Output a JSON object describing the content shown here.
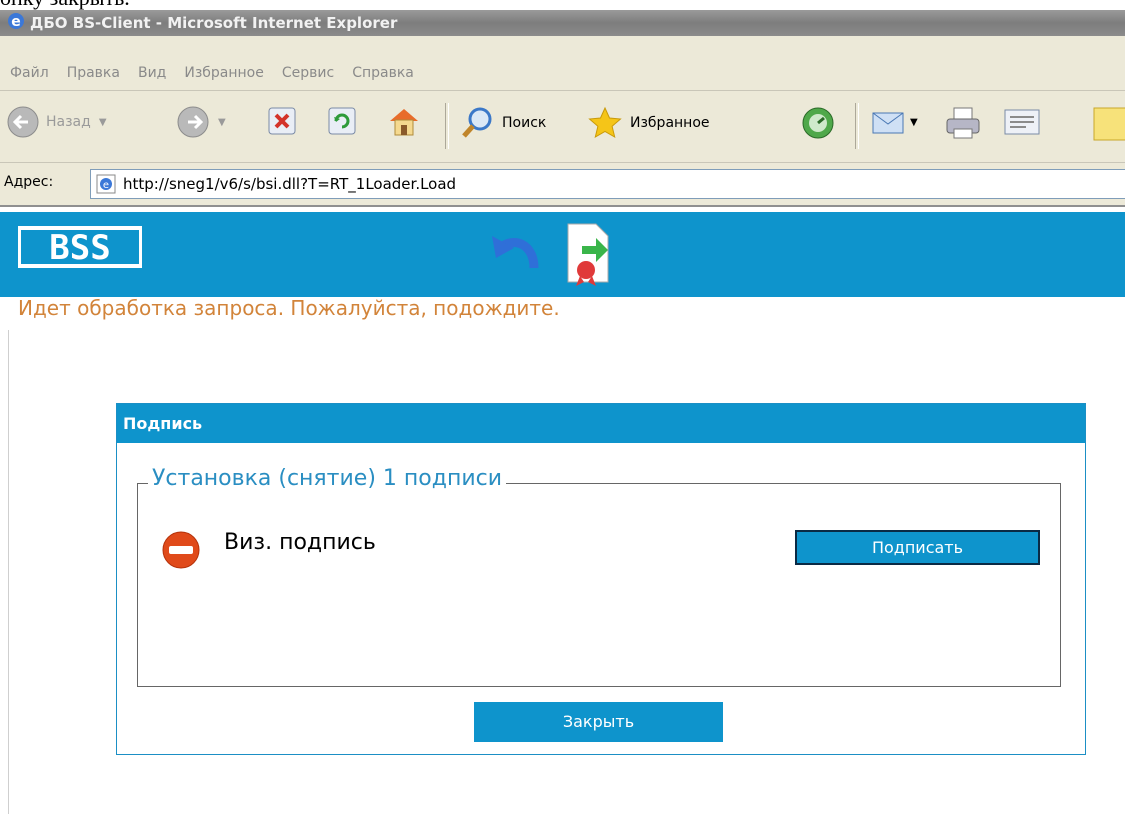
{
  "cropped_caption": "опку закрыть.",
  "window": {
    "title": "ДБО BS-Client - Microsoft Internet Explorer"
  },
  "menu": [
    "Файл",
    "Правка",
    "Вид",
    "Избранное",
    "Сервис",
    "Справка"
  ],
  "toolbar": {
    "back": "Назад",
    "search": "Поиск",
    "favorites": "Избранное"
  },
  "address": {
    "label": "Адрес:",
    "url": "http://sneg1/v6/s/bsi.dll?T=RT_1Loader.Load"
  },
  "page": {
    "logo": "BSS",
    "status": "Идет обработка запроса. Пожалуйста, подождите."
  },
  "dialog": {
    "title": "Подпись",
    "group_title": "Установка (снятие) 1 подписи",
    "signature_label": "Виз. подпись",
    "sign_button": "Подписать",
    "close_button": "Закрыть"
  },
  "colors": {
    "accent": "#0e94cc",
    "status_text": "#d2843a",
    "group_title": "#2a8ec2"
  }
}
